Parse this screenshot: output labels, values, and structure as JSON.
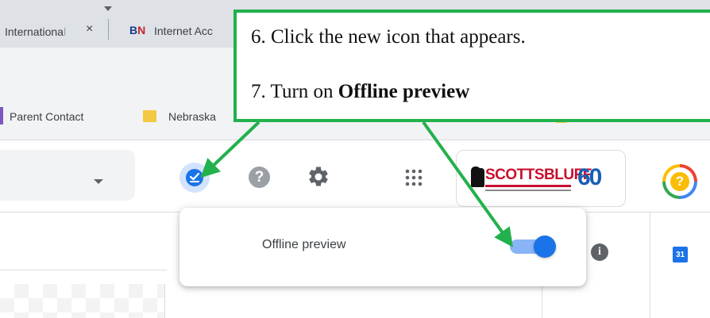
{
  "tabs": [
    {
      "title_faded_prefix": "",
      "title": "Internationa",
      "title_faded": "l",
      "close": "×"
    },
    {
      "logo_b": "B",
      "logo_n": "N",
      "title": "Internet Acc"
    }
  ],
  "bookmarks": [
    {
      "label": "Parent Contact"
    },
    {
      "label": "Nebraska"
    }
  ],
  "header": {
    "logo_text": "SCOTTSBLUFF",
    "logo_number": "60",
    "help_symbol": "?",
    "profile_symbol": "?"
  },
  "popup": {
    "label": "Offline preview",
    "toggle_on": true
  },
  "content": {
    "info_symbol": "i",
    "calendar_day": "31"
  },
  "callout": {
    "step6": "6. Click the new icon that appears.",
    "step7_prefix": "7. Turn on ",
    "step7_bold": "Offline preview"
  },
  "colors": {
    "callout_border": "#22b14c",
    "accent_blue": "#1a73e8",
    "toggle_track": "#8ab4f8",
    "logo_red": "#c8102e"
  },
  "icons": [
    "close-icon",
    "offline-check-icon",
    "help-icon",
    "gear-icon",
    "apps-grid-icon",
    "info-icon",
    "calendar-icon",
    "caret-down-icon"
  ]
}
